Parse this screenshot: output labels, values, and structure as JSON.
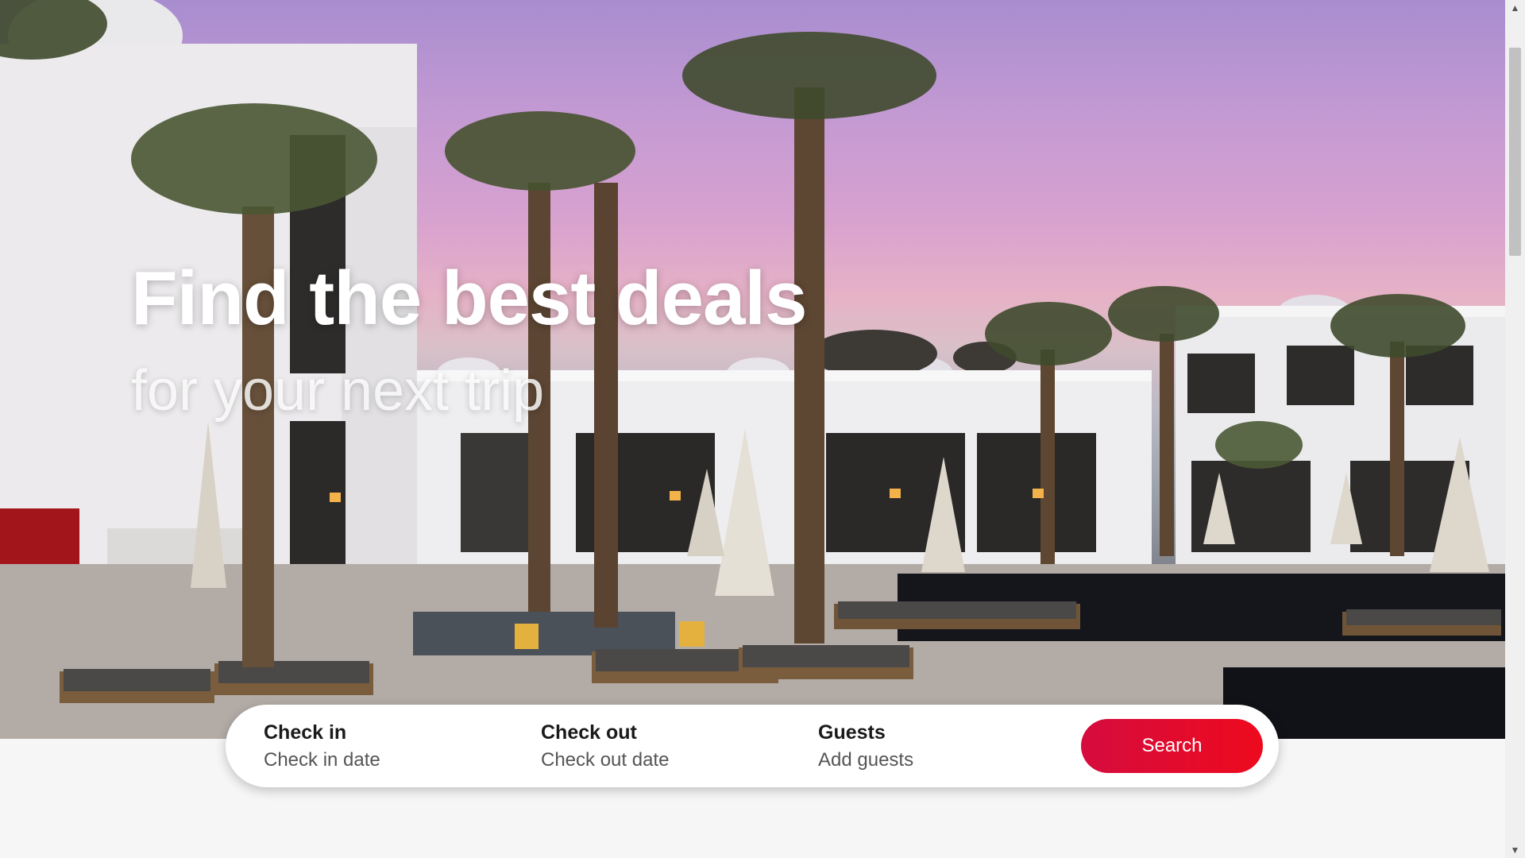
{
  "hero": {
    "headline": "Find the best deals",
    "subheadline": "for your next trip"
  },
  "search": {
    "checkin": {
      "label": "Check in",
      "value": "Check in date"
    },
    "checkout": {
      "label": "Check out",
      "value": "Check out date"
    },
    "guests": {
      "label": "Guests",
      "value": "Add guests"
    },
    "button_label": "Search"
  },
  "icons": {
    "scroll_up": "▲",
    "scroll_down": "▼"
  },
  "colors": {
    "accent_start": "#d50c3f",
    "accent_end": "#ee0a1d",
    "page_background": "#f6f6f6"
  }
}
